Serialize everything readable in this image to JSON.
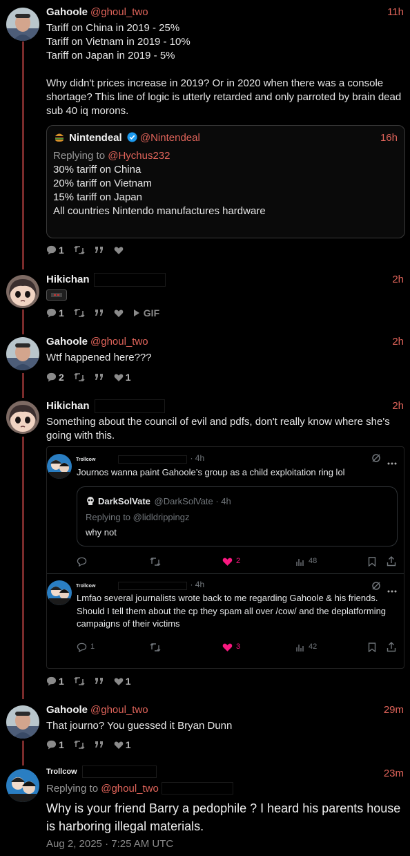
{
  "posts": [
    {
      "name": "Gahoole",
      "handle": "@ghoul_two",
      "time": "11h",
      "lines": [
        "Tariff on China in 2019 - 25%",
        "Tariff on Vietnam in 2019 - 10%",
        "Tariff on Japan in 2019 - 5%",
        "",
        "Why didn't prices increase in 2019? Or in 2020 when there was a console shortage? This line of logic is utterly retarded and only parroted by brain dead sub 40 iq morons."
      ],
      "quote": {
        "name": "Nintendeal",
        "handle": "@Nintendeal",
        "time": "16h",
        "replying_prefix": "Replying to ",
        "replying_handle": "@Hychus232",
        "lines": [
          "30% tariff on China",
          "20% tariff on Vietnam",
          "15% tariff on Japan",
          "",
          "All countries Nintendo manufactures hardware"
        ]
      },
      "reply_count": "1",
      "like_count": ""
    },
    {
      "name": "Hikichan",
      "time": "2h",
      "reply_count": "1",
      "gif_label": "GIF"
    },
    {
      "name": "Gahoole",
      "handle": "@ghoul_two",
      "time": "2h",
      "text": "Wtf happened here???",
      "reply_count": "2",
      "like_count": "1"
    },
    {
      "name": "Hikichan",
      "time": "2h",
      "text": "Something about the council of evil and pdfs, don't really know where she's going with this.",
      "reply_count": "1",
      "like_count": "1",
      "embed": {
        "tweet1": {
          "name": "Trollcow",
          "time": "· 4h",
          "text": "Journos wanna paint Gahoole’s group as a child exploitation ring lol",
          "quoted": {
            "name": "DarkSolVate",
            "handle": "@DarkSolVate · 4h",
            "replying": "Replying to @lidldrippingz",
            "text": "why not"
          },
          "likes": "2",
          "views": "48"
        },
        "tweet2": {
          "name": "Trollcow",
          "time": "· 4h",
          "text": "Lmfao several journalists wrote back to me regarding Gahoole & his friends. Should I tell them about the cp they spam all over /cow/ and the deplatforming campaigns of their victims",
          "replies": "1",
          "likes": "3",
          "views": "42"
        }
      }
    },
    {
      "name": "Gahoole",
      "handle": "@ghoul_two",
      "time": "29m",
      "text": "That journo? You guessed it Bryan Dunn",
      "reply_count": "1",
      "like_count": "1"
    },
    {
      "name": "Trollcow",
      "time": "23m",
      "replying_prefix": "Replying to ",
      "replying_handle": "@ghoul_two",
      "text": "Why is your friend Barry a pedophile ? I heard his parents house is harboring illegal materials.",
      "date": "Aug 2, 2025 · 7:25 AM UTC"
    }
  ],
  "colors": {
    "accent": "#e0645a",
    "thread_line": "#7a2b2b",
    "like_pink": "#f91880",
    "verified_blue": "#1d9bf0"
  }
}
